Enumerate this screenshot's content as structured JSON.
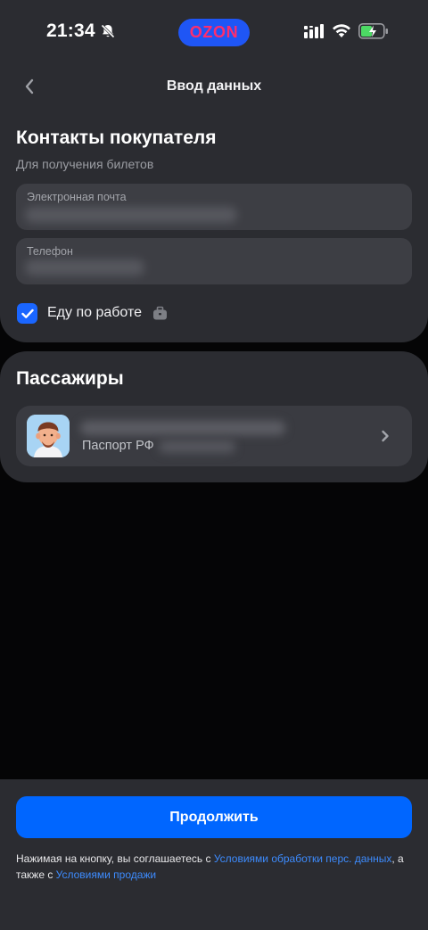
{
  "status_bar": {
    "time": "21:34",
    "app_badge": "OZON"
  },
  "nav": {
    "title": "Ввод данных",
    "back_icon": "chevron-left-icon"
  },
  "contacts": {
    "title": "Контакты покупателя",
    "subtitle": "Для получения билетов",
    "email_label": "Электронная почта",
    "phone_label": "Телефон",
    "work_checkbox_label": "Еду по работе",
    "work_checkbox_checked": true
  },
  "passengers": {
    "title": "Пассажиры",
    "items": [
      {
        "document": "Паспорт РФ"
      }
    ]
  },
  "footer": {
    "continue_label": "Продолжить",
    "legal_prefix": "Нажимая на кнопку, вы соглашаетесь с ",
    "legal_link_1": "Условиями обработки перс. данных",
    "legal_middle": ", а также с ",
    "legal_link_2": "Условиями продажи"
  },
  "colors": {
    "background": "#050506",
    "panel": "#2b2c31",
    "field": "#3d3e44",
    "accent": "#0066ff",
    "link": "#3d8cff"
  }
}
